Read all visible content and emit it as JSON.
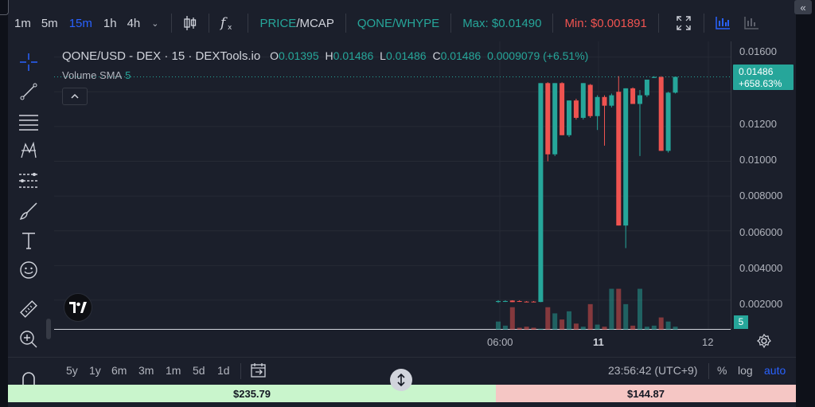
{
  "toolbar": {
    "timeframes": [
      "1m",
      "5m",
      "15m",
      "1h",
      "4h"
    ],
    "active_timeframe": "15m",
    "price_label": "PRICE",
    "mcap_label": "MCAP",
    "separator": "/",
    "pair_label": "QONE/WHYPE",
    "max_label": "Max: $0.01490",
    "min_label": "Min: $0.001891"
  },
  "legend": {
    "symbol": "QONE/USD - DEX · 15 · DEXTools.io",
    "open_key": "O",
    "open": "0.01395",
    "high_key": "H",
    "high": "0.01486",
    "low_key": "L",
    "low": "0.01486",
    "close_key": "C",
    "close": "0.01486",
    "change": "0.0009079 (+6.51%)",
    "volume_label": "Volume SMA",
    "volume_value": "5"
  },
  "price_axis": {
    "ticks": [
      "0.01600",
      "0.01200",
      "0.01000",
      "0.008000",
      "0.006000",
      "0.004000",
      "0.002000"
    ],
    "current_price": "0.01486",
    "current_change": "+658.63%",
    "volume_badge": "5"
  },
  "time_axis": {
    "ticks": [
      "06:00",
      "11",
      "12"
    ]
  },
  "bottom": {
    "ranges": [
      "5y",
      "1y",
      "6m",
      "3m",
      "1m",
      "5d",
      "1d"
    ],
    "clock": "23:56:42 (UTC+9)",
    "percent_label": "%",
    "log_label": "log",
    "auto_label": "auto"
  },
  "trade_bar": {
    "buy_value": "$235.79",
    "sell_value": "$144.87"
  },
  "colors": {
    "up": "#26a69a",
    "down": "#ef5350",
    "accent": "#2962ff",
    "background": "#1b1f2b"
  },
  "chart_data": {
    "type": "candlestick",
    "ylim": [
      0,
      0.0165
    ],
    "candles": [
      {
        "o": 0.0019,
        "h": 0.002,
        "l": 0.00185,
        "c": 0.00195
      },
      {
        "o": 0.00195,
        "h": 0.002,
        "l": 0.0019,
        "c": 0.00195
      },
      {
        "o": 0.00198,
        "h": 0.002,
        "l": 0.00189,
        "c": 0.00189
      },
      {
        "o": 0.00195,
        "h": 0.002,
        "l": 0.0019,
        "c": 0.00192
      },
      {
        "o": 0.00192,
        "h": 0.00195,
        "l": 0.00189,
        "c": 0.0019
      },
      {
        "o": 0.00192,
        "h": 0.00195,
        "l": 0.00189,
        "c": 0.0019
      },
      {
        "o": 0.0019,
        "h": 0.0145,
        "l": 0.00189,
        "c": 0.0145
      },
      {
        "o": 0.0145,
        "h": 0.01455,
        "l": 0.01,
        "c": 0.0104
      },
      {
        "o": 0.0104,
        "h": 0.0145,
        "l": 0.0103,
        "c": 0.0145
      },
      {
        "o": 0.0145,
        "h": 0.01455,
        "l": 0.0115,
        "c": 0.0115
      },
      {
        "o": 0.0115,
        "h": 0.0135,
        "l": 0.0114,
        "c": 0.0135
      },
      {
        "o": 0.0135,
        "h": 0.0136,
        "l": 0.0124,
        "c": 0.0125
      },
      {
        "o": 0.0125,
        "h": 0.0145,
        "l": 0.0124,
        "c": 0.0145
      },
      {
        "o": 0.0144,
        "h": 0.01445,
        "l": 0.0125,
        "c": 0.0126
      },
      {
        "o": 0.0126,
        "h": 0.0138,
        "l": 0.0118,
        "c": 0.0137
      },
      {
        "o": 0.0137,
        "h": 0.0138,
        "l": 0.0109,
        "c": 0.0132
      },
      {
        "o": 0.0132,
        "h": 0.0139,
        "l": 0.0131,
        "c": 0.0138
      },
      {
        "o": 0.014,
        "h": 0.0149,
        "l": 0.0063,
        "c": 0.0063
      },
      {
        "o": 0.0063,
        "h": 0.0142,
        "l": 0.005,
        "c": 0.0142
      },
      {
        "o": 0.0142,
        "h": 0.01425,
        "l": 0.0133,
        "c": 0.0133
      },
      {
        "o": 0.0133,
        "h": 0.0141,
        "l": 0.0103,
        "c": 0.0138
      },
      {
        "o": 0.0138,
        "h": 0.0147,
        "l": 0.0137,
        "c": 0.0147
      },
      {
        "o": 0.0148,
        "h": 0.0149,
        "l": 0.0148,
        "c": 0.01485
      },
      {
        "o": 0.01485,
        "h": 0.0149,
        "l": 0.0106,
        "c": 0.0106
      },
      {
        "o": 0.0106,
        "h": 0.014,
        "l": 0.0105,
        "c": 0.01395
      },
      {
        "o": 0.01395,
        "h": 0.01486,
        "l": 0.0139,
        "c": 0.01486
      }
    ],
    "volumes": [
      8,
      4,
      22,
      2,
      3,
      2,
      1,
      22,
      16,
      10,
      18,
      6,
      3,
      25,
      5,
      3,
      40,
      40,
      25,
      4,
      40,
      3,
      4,
      12,
      8,
      3
    ],
    "volume_max": 70
  }
}
